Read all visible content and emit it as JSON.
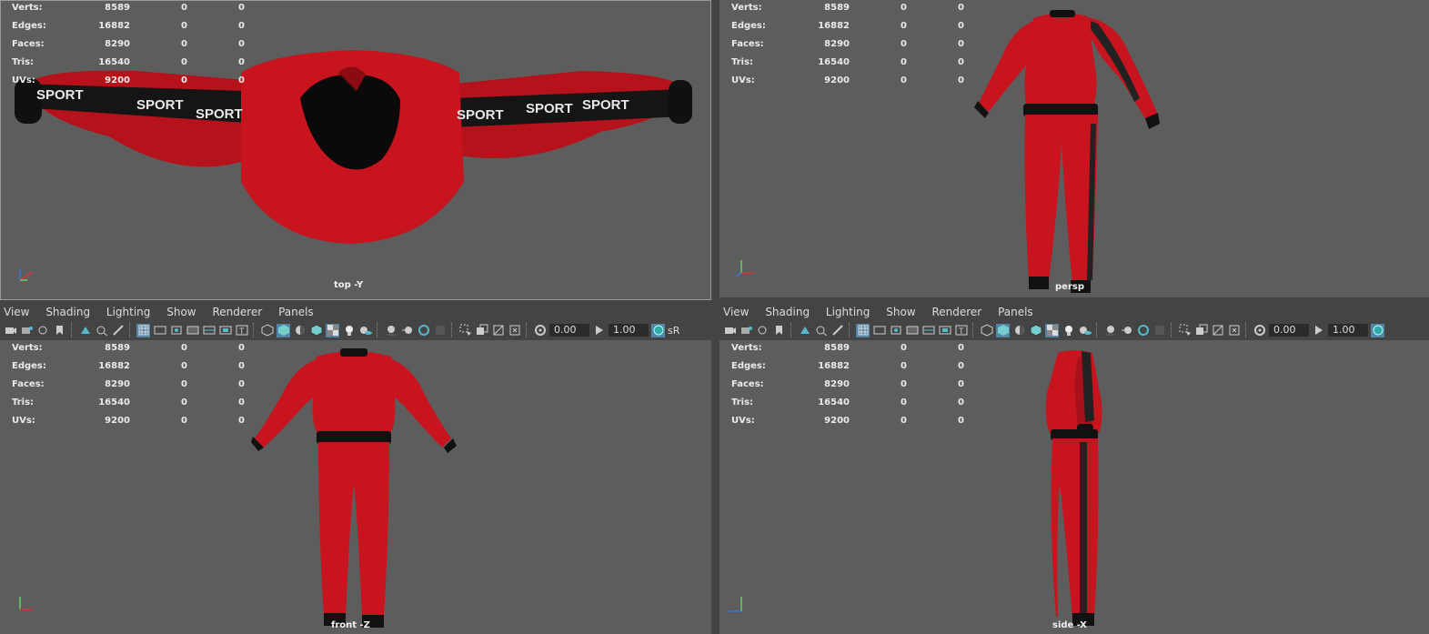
{
  "stats": {
    "rows": [
      {
        "label": "Verts:",
        "v1": "8589",
        "v2": "0",
        "v3": "0"
      },
      {
        "label": "Edges:",
        "v1": "16882",
        "v2": "0",
        "v3": "0"
      },
      {
        "label": "Faces:",
        "v1": "8290",
        "v2": "0",
        "v3": "0"
      },
      {
        "label": "Tris:",
        "v1": "16540",
        "v2": "0",
        "v3": "0"
      },
      {
        "label": "UVs:",
        "v1": "9200",
        "v2": "0",
        "v3": "0"
      }
    ]
  },
  "viewports": {
    "top": {
      "camera": "top -Y"
    },
    "persp": {
      "camera": "persp"
    },
    "front": {
      "camera": "front -Z"
    },
    "side": {
      "camera": "side -X"
    }
  },
  "menu": {
    "items": [
      "View",
      "Shading",
      "Lighting",
      "Show",
      "Renderer",
      "Panels"
    ]
  },
  "toolbar": {
    "exposure": "0.00",
    "gamma": "1.00",
    "cutoff_label": "sR"
  },
  "texture": {
    "sleeve_text": "SPORT",
    "star": "★"
  },
  "colors": {
    "viewport_bg": "#5d5d5d",
    "ui_bg": "#444444",
    "suit_red": "#c8141e",
    "cuff_black": "#111111",
    "highlight": "#5285a6"
  }
}
